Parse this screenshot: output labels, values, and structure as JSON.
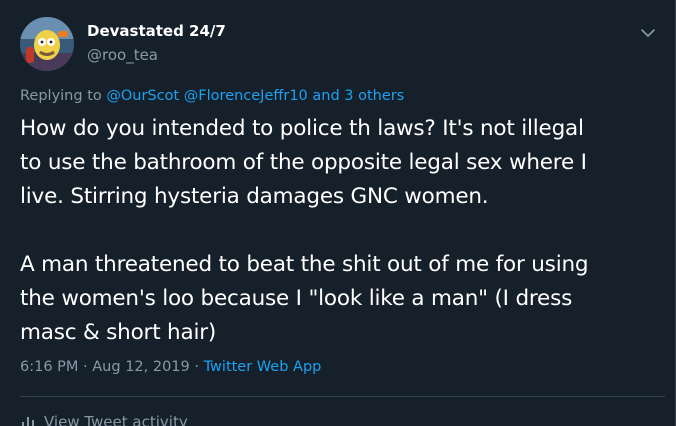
{
  "colors": {
    "background": "#15202b",
    "text_primary": "#ffffff",
    "text_secondary": "#8899a6",
    "link": "#1da1f2",
    "border": "#38444d"
  },
  "author": {
    "display_name": "Devastated 24/7",
    "handle": "@roo_tea",
    "avatar_icon": "avatar-icon"
  },
  "reply_context": {
    "prefix": "Replying to",
    "mention_1": "@OurScot",
    "mention_2": "@FlorenceJeffr10",
    "others": "and 3 others"
  },
  "tweet": {
    "lines_para1": [
      "How do you intended to police th laws? It's not illegal",
      "to use the bathroom of the opposite legal sex where I",
      "live. Stirring hysteria damages GNC women."
    ],
    "lines_para2": [
      "A man threatened to beat the shit out of me for using",
      "the women's loo because I \"look like a man\" (I dress",
      "masc & short hair)"
    ]
  },
  "meta": {
    "time": "6:16 PM",
    "separator": "·",
    "date": "Aug 12, 2019",
    "source": "Twitter Web App"
  },
  "activity": {
    "label": "View Tweet activity",
    "icon": "bar-chart-icon"
  },
  "menu": {
    "icon": "chevron-down-icon"
  }
}
